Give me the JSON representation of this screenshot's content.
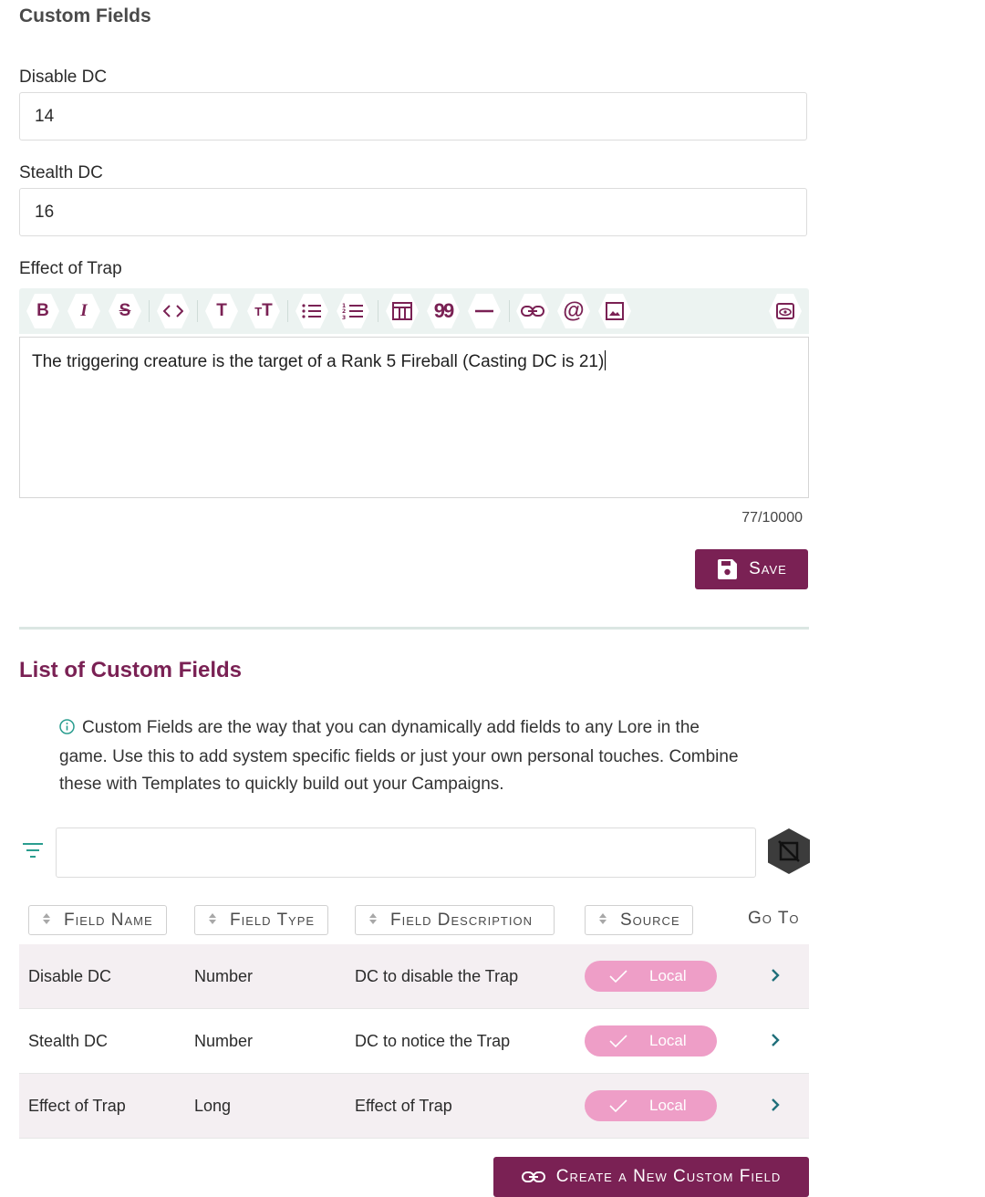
{
  "header": {
    "title": "Custom Fields"
  },
  "form": {
    "disable_dc": {
      "label": "Disable DC",
      "value": "14"
    },
    "stealth_dc": {
      "label": "Stealth DC",
      "value": "16"
    },
    "effect": {
      "label": "Effect of Trap",
      "text": "The triggering creature is the target of a Rank 5 Fireball (Casting DC is 21)",
      "counter": "77/10000"
    },
    "toolbar_icons": [
      "bold-icon",
      "italic-icon",
      "strikethrough-icon",
      "code-icon",
      "text-size-icon",
      "heading-icon",
      "bulleted-list-icon",
      "numbered-list-icon",
      "table-icon",
      "quote-icon",
      "horizontal-rule-icon",
      "link-icon",
      "mention-icon",
      "image-icon",
      "preview-icon"
    ],
    "save_label": "Save"
  },
  "list": {
    "title": "List of Custom Fields",
    "info": "Custom Fields are the way that you can dynamically add fields to any Lore in the game. Use this to add system specific fields or just your own personal touches. Combine these with Templates to quickly build out your Campaigns.",
    "filter_placeholder": "",
    "columns": {
      "field_name": "Field Name",
      "field_type": "Field Type",
      "field_description": "Field Description",
      "source": "Source",
      "go_to": "Go To"
    },
    "rows": [
      {
        "name": "Disable DC",
        "type": "Number",
        "description": "DC to disable the Trap",
        "source": "Local"
      },
      {
        "name": "Stealth DC",
        "type": "Number",
        "description": "DC to notice the Trap",
        "source": "Local"
      },
      {
        "name": "Effect of Trap",
        "type": "Long",
        "description": "Effect of Trap",
        "source": "Local"
      }
    ],
    "create_label": "Create a New Custom Field"
  },
  "colors": {
    "accent": "#7a2154",
    "pill": "#ee9ec7",
    "teal": "#2a9d8f"
  }
}
